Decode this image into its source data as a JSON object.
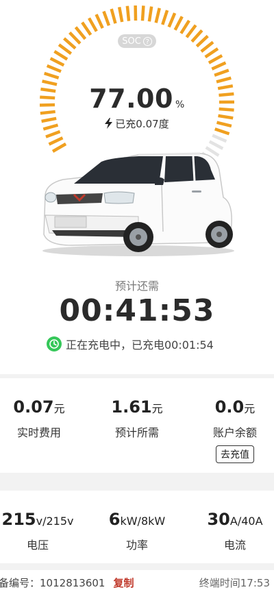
{
  "gauge": {
    "soc_badge": "SOC",
    "soc_help_icon": "?",
    "percent_value": "77.00",
    "percent_unit": "%",
    "charged_text": "已充0.07度",
    "fill_fraction": 0.77,
    "colors": {
      "filled": "#f0a020",
      "empty": "#e3e3e3"
    }
  },
  "countdown": {
    "label": "预计还需",
    "time": "00:41:53",
    "status_text": "正在充电中，已充电00:01:54"
  },
  "stats_top": [
    {
      "value": "0.07",
      "unit": "元",
      "label": "实时费用"
    },
    {
      "value": "1.61",
      "unit": "元",
      "label": "预计所需"
    },
    {
      "value": "0.0",
      "unit": "元",
      "label": "账户余额",
      "button": "去充值"
    }
  ],
  "stats_bottom": [
    {
      "value": "215",
      "unit": "v/215v",
      "label": "电压"
    },
    {
      "value": "6",
      "unit": "kW/8kW",
      "label": "功率"
    },
    {
      "value": "30",
      "unit": "A/40A",
      "label": "电流"
    }
  ],
  "footer": {
    "device_prefix": "备编号：",
    "device_id": "1012813601",
    "copy_label": "复制",
    "terminal_time_label": "终端时间",
    "terminal_time": "17:53"
  }
}
